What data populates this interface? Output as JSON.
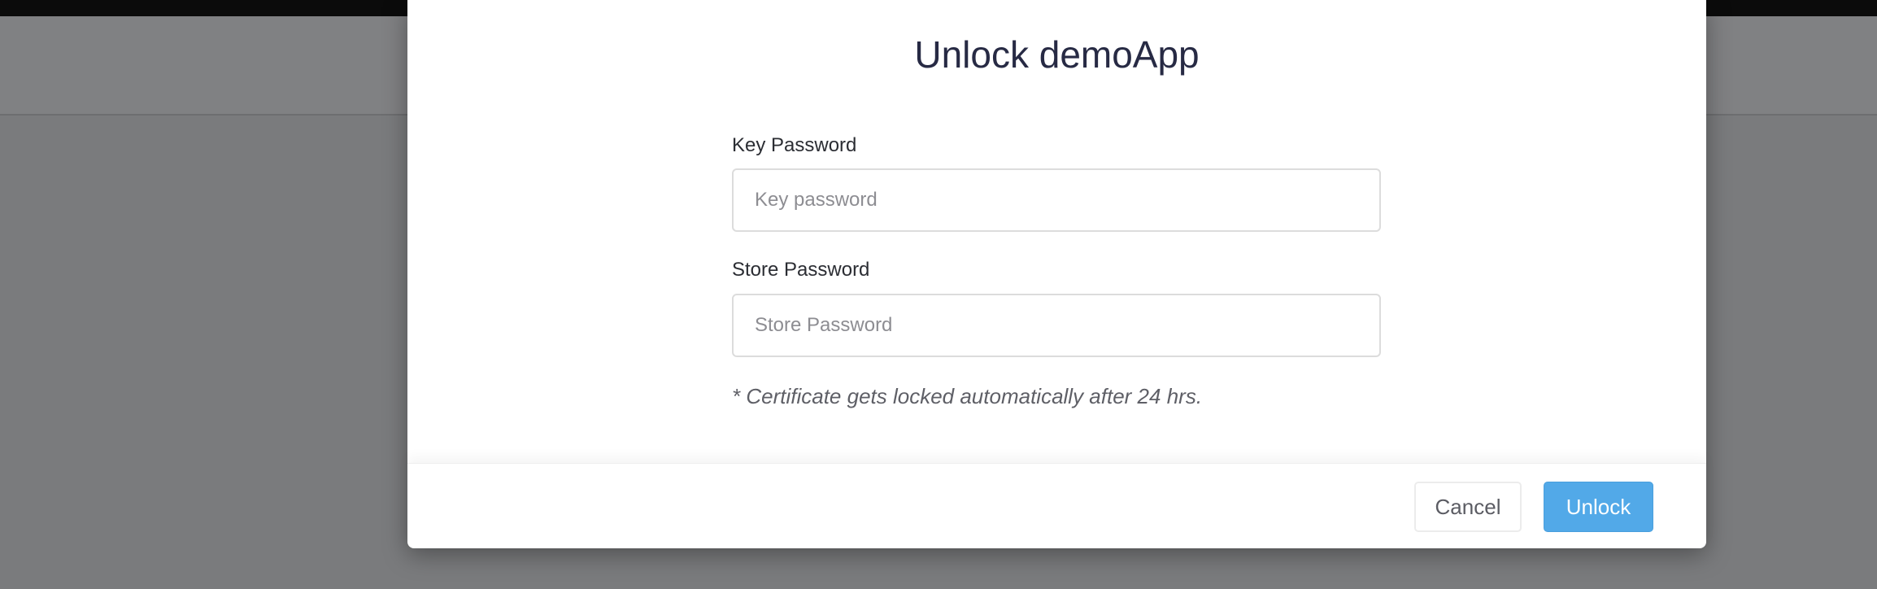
{
  "modal": {
    "title": "Unlock demoApp",
    "key_password": {
      "label": "Key Password",
      "placeholder": "Key password",
      "value": ""
    },
    "store_password": {
      "label": "Store Password",
      "placeholder": "Store Password",
      "value": ""
    },
    "note": "* Certificate gets locked automatically after 24 hrs.",
    "cancel_label": "Cancel",
    "unlock_label": "Unlock"
  },
  "colors": {
    "primary": "#52a9e8",
    "title": "#272a44"
  }
}
